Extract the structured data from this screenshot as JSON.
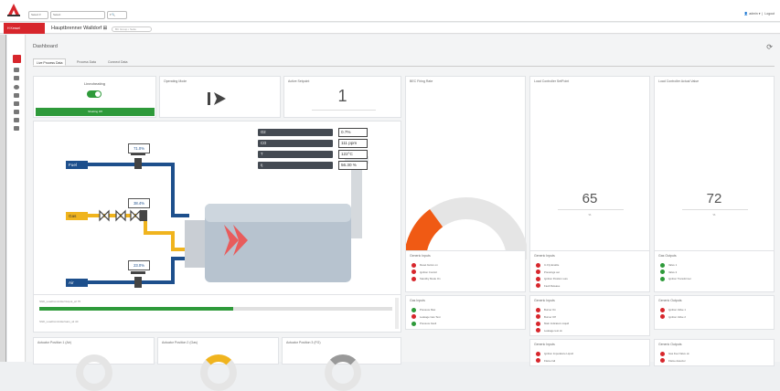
{
  "topbar": {
    "select1": "Select ▾",
    "select2": "Select",
    "select3": "▾  🔍",
    "user": "admin ▾",
    "logout": "Logout"
  },
  "redbar": {
    "pill_label": "H  Kessel",
    "device_title": "Hauptbrenner Walldorf ⊞",
    "badge": "BC Group • Seite"
  },
  "dashboard": {
    "title": "Dashboard",
    "tabs": [
      "Live Process Data",
      "Process Data",
      "Connect Data"
    ]
  },
  "colors": {
    "accent": "#d7262c",
    "ok": "#2e9a3a",
    "fuel": "#1d4f8c",
    "gas": "#f0b41e",
    "gauge": "#f05a14"
  },
  "flame": {
    "title": "Lineoheating",
    "button": "Shutting Off"
  },
  "operating_mode": {
    "title": "Operating Mode"
  },
  "active_setpoint": {
    "title": "Active Setpoint",
    "value": "1"
  },
  "measurements": [
    {
      "label": "O2",
      "value": "0.7%"
    },
    {
      "label": "CO",
      "value": "111 ppm"
    },
    {
      "label": "T",
      "value": "122°C"
    },
    {
      "label": "η",
      "value": "56.30 %"
    }
  ],
  "diagram": {
    "fuel_label": "Fuel",
    "gas_label": "Gas",
    "air_label": "Air",
    "fuel_value": "71.0%",
    "gas_value": "38.4%",
    "air_value": "23.0%"
  },
  "firing_rate": {
    "title": "BEC Firing Rate",
    "value": "208",
    "unit": "kg/h",
    "min": "0",
    "max": "300",
    "fraction": 0.3
  },
  "lc_setpoint": {
    "title": "Load Controller SetPoint",
    "value": "65",
    "unit": "%"
  },
  "lc_actual": {
    "title": "Load Controller Actual Value",
    "value": "72",
    "unit": "%"
  },
  "progress": {
    "row1": "Shift_LoadControllerOutput_wl  75",
    "row2": "Shift_LoadControllerGain_wl  40",
    "fraction": 0.55
  },
  "generic_inputs_1": {
    "title": "Generic Inputs",
    "items": [
      {
        "label": "Reset button on",
        "status": "red"
      },
      {
        "label": "Ignition Control",
        "status": "red"
      },
      {
        "label": "Standby Mode On",
        "status": "red"
      }
    ]
  },
  "generic_inputs_2": {
    "title": "Generic Inputs",
    "items": [
      {
        "label": "In Fly Enable",
        "status": "red"
      },
      {
        "label": "Pressings out",
        "status": "red"
      },
      {
        "label": "Ignition Position sure",
        "status": "red"
      },
      {
        "label": "Fault Release",
        "status": "red"
      }
    ]
  },
  "gas_outputs": {
    "title": "Gas Outputs",
    "items": [
      {
        "label": "Valve 1",
        "status": "green"
      },
      {
        "label": "Valve 2",
        "status": "green"
      },
      {
        "label": "Ignition Transformer",
        "status": "green"
      }
    ]
  },
  "gas_inputs": {
    "title": "Gas Inputs",
    "items": [
      {
        "label": "Pressure Max",
        "status": "green"
      },
      {
        "label": "Leakage Gas Test",
        "status": "red"
      },
      {
        "label": "Pressure Fault",
        "status": "green"
      }
    ]
  },
  "generic_inputs_3": {
    "title": "Generic Inputs",
    "items": [
      {
        "label": "Burner On",
        "status": "red"
      },
      {
        "label": "Burner Off",
        "status": "red"
      },
      {
        "label": "Main Indicators Liquid",
        "status": "red"
      },
      {
        "label": "Leakage test ok",
        "status": "red"
      }
    ]
  },
  "generic_outputs_1": {
    "title": "Generic Outputs",
    "items": [
      {
        "label": "Ignition Valve 1",
        "status": "red"
      },
      {
        "label": "Ignition Valve 2",
        "status": "red"
      }
    ]
  },
  "generic_inputs_4": {
    "title": "Generic Inputs",
    "items": [
      {
        "label": "Ignition Impedance Liquid",
        "status": "red"
      },
      {
        "label": "Flame fail",
        "status": "red"
      }
    ]
  },
  "generic_outputs_2": {
    "title": "Generic Outputs",
    "items": [
      {
        "label": "Gas Fuel Valve ok",
        "status": "red"
      },
      {
        "label": "Flame detector",
        "status": "red"
      }
    ]
  },
  "actuators": {
    "act1": "Actuator Position 1 (Air)",
    "act2": "Actuator Position 2 (Gas)",
    "act3": "Actuator Position 3 (FG)"
  }
}
